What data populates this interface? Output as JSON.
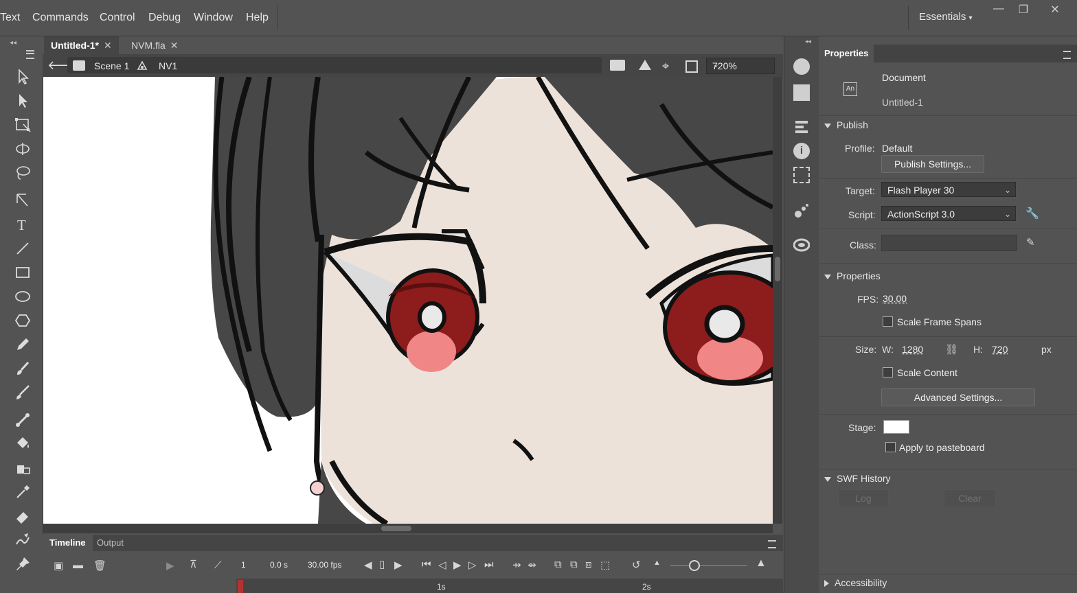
{
  "menubar": {
    "items": [
      "Text",
      "Commands",
      "Control",
      "Debug",
      "Window",
      "Help"
    ],
    "workspace": "Essentials"
  },
  "tabs": [
    {
      "label": "Untitled-1*",
      "active": true
    },
    {
      "label": "NVM.fla",
      "active": false
    }
  ],
  "editbar": {
    "scene": "Scene 1",
    "symbol": "NV1",
    "zoom": "720%"
  },
  "properties": {
    "panel_title": "Properties",
    "doc_type": "Document",
    "doc_name": "Untitled-1",
    "publish": {
      "section": "Publish",
      "profile_label": "Profile:",
      "profile_value": "Default",
      "settings_button": "Publish Settings...",
      "target_label": "Target:",
      "target_value": "Flash Player 30",
      "script_label": "Script:",
      "script_value": "ActionScript 3.0",
      "class_label": "Class:"
    },
    "props": {
      "section": "Properties",
      "fps_label": "FPS:",
      "fps_value": "30.00",
      "scale_spans": "Scale Frame Spans",
      "size_label": "Size:",
      "w_label": "W:",
      "w_value": "1280",
      "h_label": "H:",
      "h_value": "720",
      "unit": "px",
      "scale_content": "Scale Content",
      "advanced_button": "Advanced Settings...",
      "stage_label": "Stage:",
      "stage_color": "#ffffff",
      "pasteboard": "Apply to pasteboard"
    },
    "swf": {
      "section": "SWF History",
      "log": "Log",
      "clear": "Clear"
    },
    "accessibility": "Accessibility"
  },
  "timeline": {
    "tabs": [
      "Timeline",
      "Output"
    ],
    "frame": "1",
    "time": "0.0 s",
    "fps": "30.00 fps",
    "ruler": [
      "1s",
      "2s"
    ]
  },
  "colors": {
    "skin": "#ede2da",
    "hair": "#474747",
    "iris": "#8d1c1c",
    "pupil_highlight": "#f08686"
  }
}
